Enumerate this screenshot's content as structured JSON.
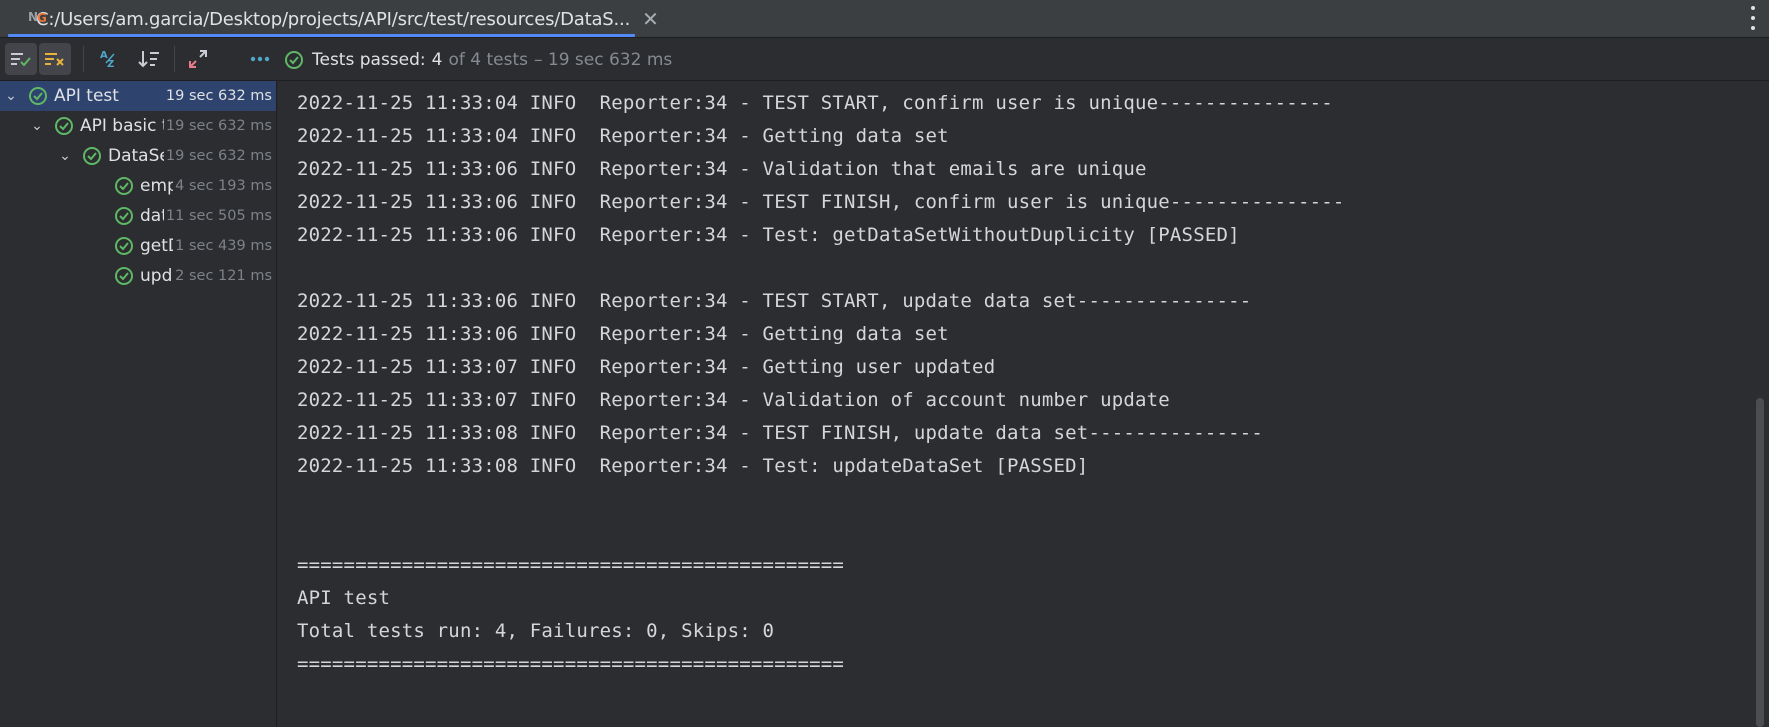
{
  "tab": {
    "title": "C:/Users/am.garcia/Desktop/projects/API/src/test/resources/DataS...",
    "close": "✕",
    "icon": "testng-icon"
  },
  "toolbar": {
    "buttons": [
      "show-passed",
      "show-ignored",
      "sort-alphabetically",
      "sort-by-duration",
      "expand-all",
      "more-options"
    ]
  },
  "status": {
    "label": "Tests passed:",
    "count": "4",
    "rest": "of 4 tests",
    "time": "– 19 sec 632 ms"
  },
  "tree": [
    {
      "name": "API test",
      "time": "19 sec 632 ms",
      "level": 0,
      "chevron": "⌄",
      "selected": true
    },
    {
      "name": "API basic t",
      "time": "19 sec 632 ms",
      "level": 1,
      "chevron": "⌄",
      "selected": false
    },
    {
      "name": "DataSe",
      "time": "19 sec 632 ms",
      "level": 2,
      "chevron": "⌄",
      "selected": false
    },
    {
      "name": "emp",
      "time": "4 sec 193 ms",
      "level": 3,
      "chevron": "",
      "selected": false
    },
    {
      "name": "data",
      "time": "11 sec 505 ms",
      "level": 3,
      "chevron": "",
      "selected": false
    },
    {
      "name": "getD",
      "time": "1 sec 439 ms",
      "level": 3,
      "chevron": "",
      "selected": false
    },
    {
      "name": "upda",
      "time": "2 sec 121 ms",
      "level": 3,
      "chevron": "",
      "selected": false
    }
  ],
  "console": {
    "lines": [
      "2022-11-25 11:33:04 INFO  Reporter:34 - TEST START, confirm user is unique---------------",
      "2022-11-25 11:33:04 INFO  Reporter:34 - Getting data set",
      "2022-11-25 11:33:06 INFO  Reporter:34 - Validation that emails are unique",
      "2022-11-25 11:33:06 INFO  Reporter:34 - TEST FINISH, confirm user is unique---------------",
      "2022-11-25 11:33:06 INFO  Reporter:34 - Test: getDataSetWithoutDuplicity [PASSED]",
      "",
      "2022-11-25 11:33:06 INFO  Reporter:34 - TEST START, update data set---------------",
      "2022-11-25 11:33:06 INFO  Reporter:34 - Getting data set",
      "2022-11-25 11:33:07 INFO  Reporter:34 - Getting user updated",
      "2022-11-25 11:33:07 INFO  Reporter:34 - Validation of account number update",
      "2022-11-25 11:33:08 INFO  Reporter:34 - TEST FINISH, update data set---------------",
      "2022-11-25 11:33:08 INFO  Reporter:34 - Test: updateDataSet [PASSED]",
      "",
      "",
      "===============================================",
      "API test",
      "Total tests run: 4, Failures: 0, Skips: 0",
      "==============================================="
    ]
  },
  "colors": {
    "background": "#2b2d30",
    "accent": "#548af7",
    "selection": "#2e436e",
    "pass": "#5fb865"
  }
}
